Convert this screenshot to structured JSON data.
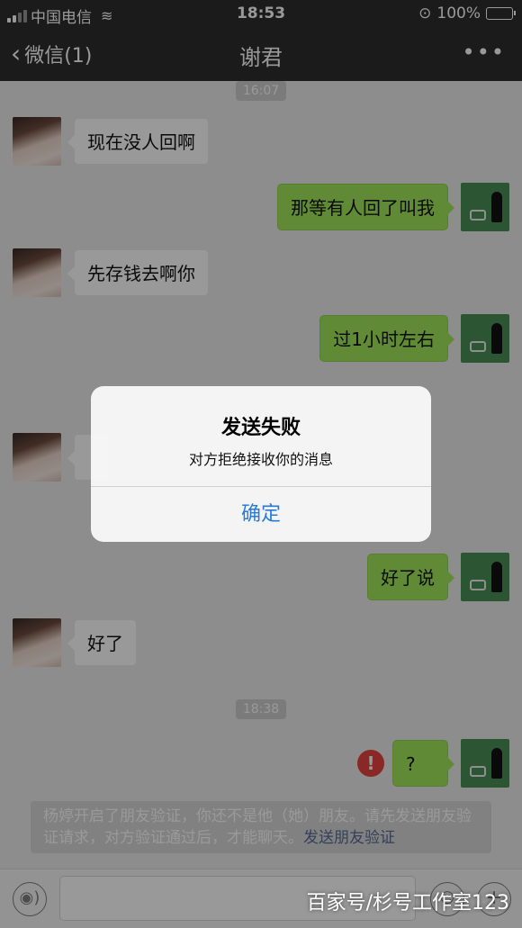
{
  "status_bar": {
    "carrier": "中国电信",
    "time": "18:53",
    "battery": "100%"
  },
  "nav": {
    "back_label": "微信(1)",
    "title": "谢君",
    "more": "•••"
  },
  "messages": {
    "time1": "16:07",
    "m1": "现在没人回啊",
    "m2": "那等有人回了叫我",
    "m3": "先存钱去啊你",
    "m4": "过1小时左右",
    "m5": "好了说",
    "m6": "好了",
    "time2": "18:38",
    "m7": "?",
    "fail_mark": "!"
  },
  "notice": {
    "text": "杨婷开启了朋友验证，你还不是他（她）朋友。请先发送朋友验证请求，对方验证通过后，才能聊天。",
    "link": "发送朋友验证"
  },
  "alert": {
    "title": "发送失败",
    "message": "对方拒绝接收你的消息",
    "confirm": "确定"
  },
  "input_bar": {
    "voice": "◉)",
    "emoji": "☺",
    "plus": "+",
    "placeholder": ""
  },
  "watermark": "百家号/杉号工作室123"
}
